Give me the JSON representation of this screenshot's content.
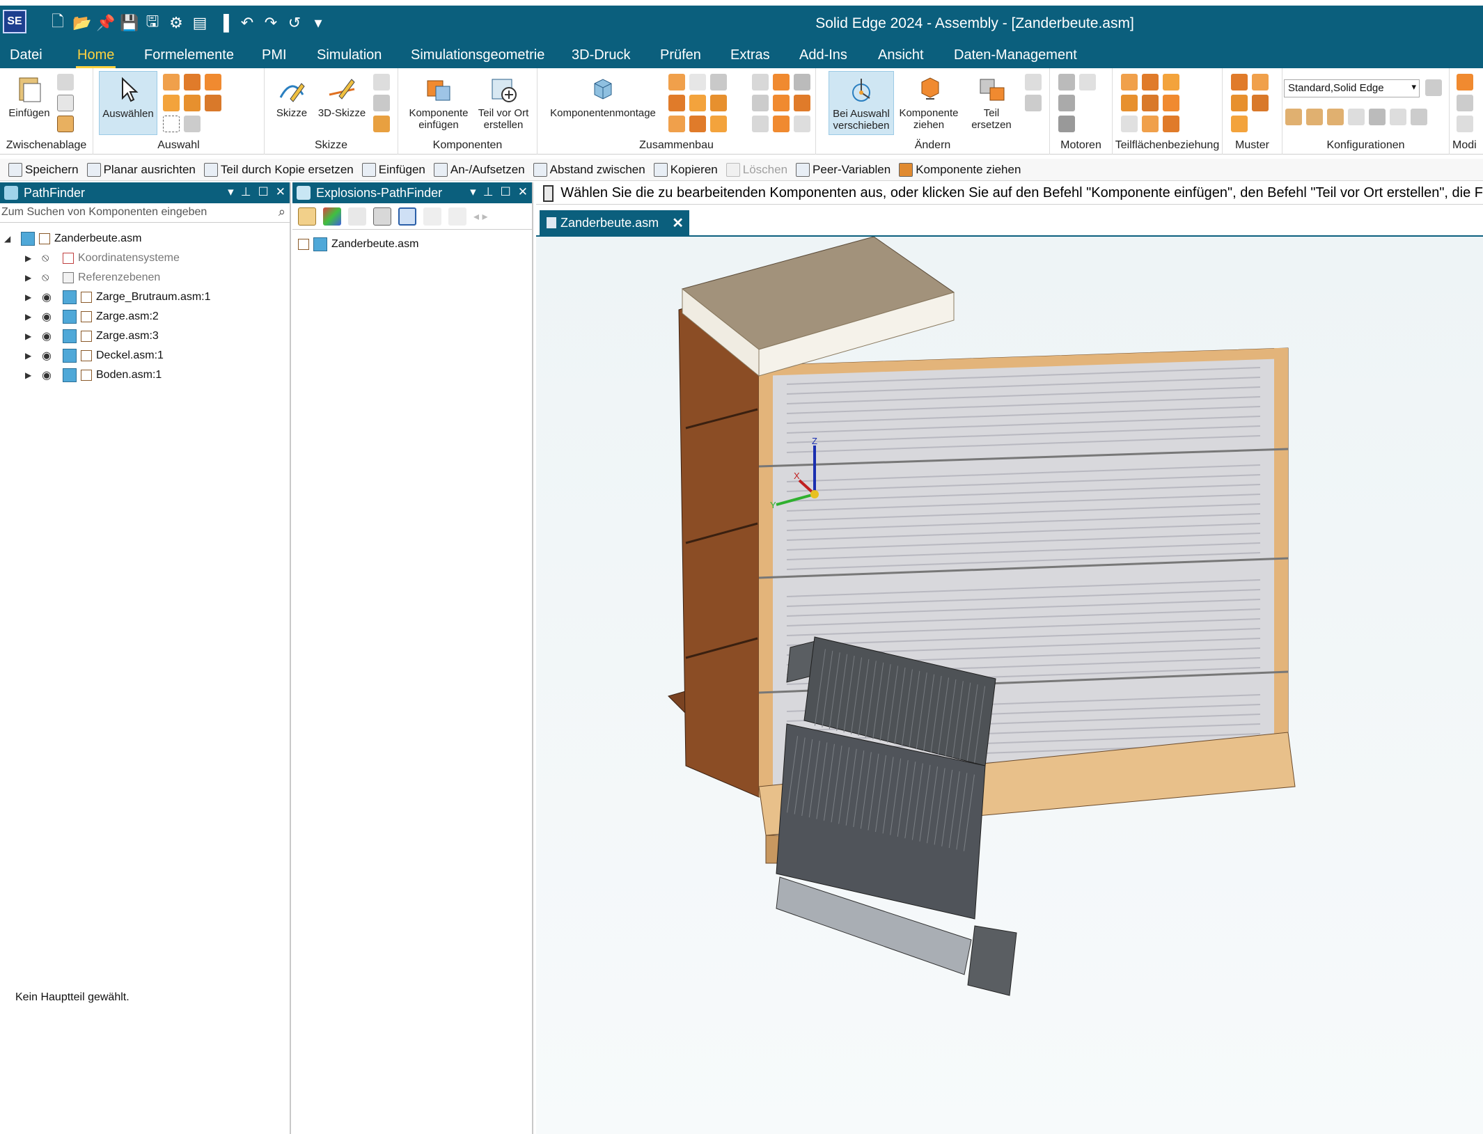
{
  "app": {
    "logo": "SE",
    "title": "Solid Edge 2024 - Assembly - [Zanderbeute.asm]"
  },
  "menu": {
    "tabs": [
      "Datei",
      "Home",
      "Formelemente",
      "PMI",
      "Simulation",
      "Simulationsgeometrie",
      "3D-Druck",
      "Prüfen",
      "Extras",
      "Add-Ins",
      "Ansicht",
      "Daten-Management"
    ],
    "active": "Home"
  },
  "ribbon": {
    "groups": {
      "zwischenablage": "Zwischenablage",
      "auswahl": "Auswahl",
      "skizze": "Skizze",
      "komponenten": "Komponenten",
      "zusammenbau": "Zusammenbau",
      "aendern": "Ändern",
      "motoren": "Motoren",
      "teilflaechen": "Teilflächenbeziehung",
      "muster": "Muster",
      "konfigurationen": "Konfigurationen",
      "modi": "Modi"
    },
    "buttons": {
      "einfuegen": "Einfügen",
      "auswaehlen": "Auswählen",
      "skizze": "Skizze",
      "skizze3d": "3D-Skizze",
      "komponente_einfuegen_1": "Komponente",
      "komponente_einfuegen_2": "einfügen",
      "teil_vor_ort_1": "Teil vor Ort",
      "teil_vor_ort_2": "erstellen",
      "komponentenmontage": "Komponentenmontage",
      "bei_auswahl_1": "Bei Auswahl",
      "bei_auswahl_2": "verschieben",
      "komponente_ziehen_1": "Komponente",
      "komponente_ziehen_2": "ziehen",
      "teil_ersetzen_1": "Teil",
      "teil_ersetzen_2": "ersetzen"
    },
    "config_select": "Standard,Solid Edge"
  },
  "commandbar": {
    "items": [
      "Speichern",
      "Planar ausrichten",
      "Teil durch Kopie ersetzen",
      "Einfügen",
      "An-/Aufsetzen",
      "Abstand zwischen",
      "Kopieren",
      "Löschen",
      "Peer-Variablen",
      "Komponente ziehen"
    ],
    "disabled": [
      "Löschen"
    ]
  },
  "pathfinder": {
    "title": "PathFinder",
    "search_placeholder": "Zum Suchen von Komponenten eingeben",
    "root": "Zanderbeute.asm",
    "items": [
      "Koordinatensysteme",
      "Referenzebenen",
      "Zarge_Brutraum.asm:1",
      "Zarge.asm:2",
      "Zarge.asm:3",
      "Deckel.asm:1",
      "Boden.asm:1"
    ],
    "status": "Kein Hauptteil gewählt."
  },
  "explosion": {
    "title": "Explosions-PathFinder",
    "root": "Zanderbeute.asm"
  },
  "prompt": "Wählen Sie die zu bearbeitenden Komponenten aus, oder klicken Sie auf den Befehl \"Komponente einfügen\", den Befehl \"Teil vor Ort erstellen\", die F",
  "document_tab": "Zanderbeute.asm",
  "axes": {
    "x": "X",
    "y": "Y",
    "z": "Z"
  },
  "colors": {
    "accent": "#0b5f7d",
    "active_tab": "#ffd23f",
    "wood": "#8a4e26",
    "lid": "#9c8b75",
    "mesh": "#555a5e"
  }
}
